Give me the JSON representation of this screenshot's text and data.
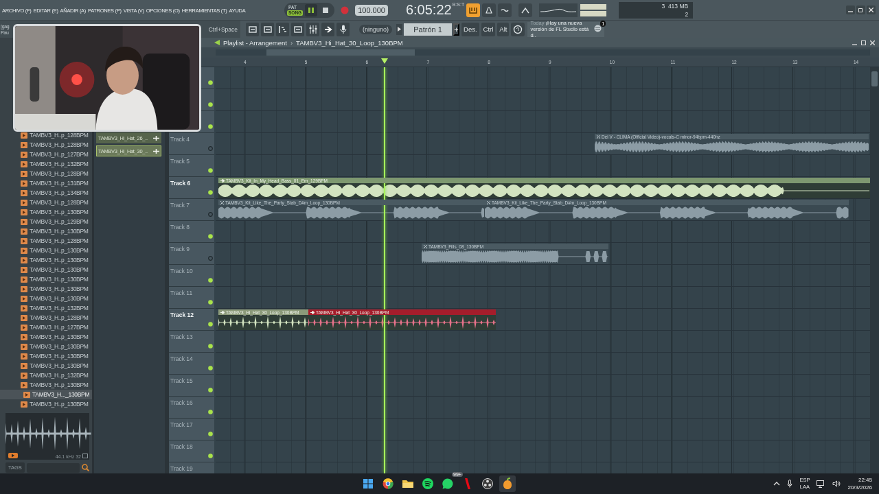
{
  "menu": [
    "ARCHIVO (F)",
    "EDITAR (E)",
    "AÑADIR (A)",
    "PATRONES (P)",
    "VISTA (V)",
    "OPCIONES (O)",
    "HERRAMIENTAS (T)",
    "AYUDA"
  ],
  "transport": {
    "modes": [
      {
        "label": "PAT",
        "selected": false
      },
      {
        "label": "SONG",
        "selected": true
      }
    ],
    "tempo": "100.000",
    "time": "6:05:22",
    "time_unit": "B:S:T",
    "cpu": "3",
    "memory": "413 MB",
    "polyphony": "2"
  },
  "hint_bar": {
    "lines": [
      "[gag",
      "Pau"
    ],
    "shortcut": "Ctrl+Space"
  },
  "pattern_selector": {
    "none_label": "(ninguno)",
    "pattern": "Patrón 1",
    "add": "+"
  },
  "snap_buttons": [
    "Des.",
    "Ctrl",
    "Alt"
  ],
  "news": {
    "when": "Today",
    "text": "¡Hay una nueva versión de FL Studio está d..",
    "count": "1"
  },
  "browser": {
    "items": [
      {
        "name": "TAMBV3_H..p_128BPM",
        "selected": false
      },
      {
        "name": "TAMBV3_H..p_128BPM",
        "selected": false
      },
      {
        "name": "TAMBV3_H..p_127BPM",
        "selected": false
      },
      {
        "name": "TAMBV3_H..p_132BPM",
        "selected": false
      },
      {
        "name": "TAMBV3_H..p_128BPM",
        "selected": false
      },
      {
        "name": "TAMBV3_H..p_131BPM",
        "selected": false
      },
      {
        "name": "TAMBV3_H..p_134BPM",
        "selected": false
      },
      {
        "name": "TAMBV3_H..p_128BPM",
        "selected": false
      },
      {
        "name": "TAMBV3_H..p_130BPM",
        "selected": false
      },
      {
        "name": "TAMBV3_H..p_129BPM",
        "selected": false
      },
      {
        "name": "TAMBV3_H..p_130BPM",
        "selected": false
      },
      {
        "name": "TAMBV3_H..p_128BPM",
        "selected": false
      },
      {
        "name": "TAMBV3_H..p_130BPM",
        "selected": false
      },
      {
        "name": "TAMBV3_H..p_130BPM",
        "selected": false
      },
      {
        "name": "TAMBV3_H..p_130BPM",
        "selected": false
      },
      {
        "name": "TAMBV3_H..p_130BPM",
        "selected": false
      },
      {
        "name": "TAMBV3_H..p_130BPM",
        "selected": false
      },
      {
        "name": "TAMBV3_H..p_130BPM",
        "selected": false
      },
      {
        "name": "TAMBV3_H..p_132BPM",
        "selected": false
      },
      {
        "name": "TAMBV3_H..p_128BPM",
        "selected": false
      },
      {
        "name": "TAMBV3_H..p_127BPM",
        "selected": false
      },
      {
        "name": "TAMBV3_H..p_130BPM",
        "selected": false
      },
      {
        "name": "TAMBV3_H..p_130BPM",
        "selected": false
      },
      {
        "name": "TAMBV3_H..p_130BPM",
        "selected": false
      },
      {
        "name": "TAMBV3_H..p_130BPM",
        "selected": false
      },
      {
        "name": "TAMBV3_H..p_132BPM",
        "selected": false
      },
      {
        "name": "TAMBV3_H..p_130BPM",
        "selected": false
      },
      {
        "name": "TAMBV3_H..._130BPM",
        "selected": true
      },
      {
        "name": "TAMBV3_H..p_130BPM",
        "selected": false
      }
    ],
    "preview_info": "44.1 kHz 32",
    "tags": "TAGS"
  },
  "picker": {
    "items": [
      {
        "name": "TAMBV3_Hi_Hat_26_..",
        "selected": false
      },
      {
        "name": "TAMBV3_Hi_Hat_30_..",
        "selected": true
      }
    ]
  },
  "playlist": {
    "title": "Playlist - Arrangement",
    "separator": "›",
    "pattern": "TAMBV3_Hi_Hat_30_Loop_130BPM",
    "ruler": [
      "4",
      "5",
      "6",
      "7",
      "8",
      "9",
      "10",
      "11",
      "12",
      "13",
      "14"
    ],
    "tracks": [
      {
        "enabled": true
      },
      {
        "enabled": true
      },
      {
        "enabled": true
      },
      {
        "label": "Track 4",
        "enabled": false,
        "active": false,
        "clips": [
          {
            "name": "Dei V - CLIMA (Official Video)-vocals-C minor-94bpm-440hz",
            "color": "#4a5a62",
            "muted": true,
            "kind": "vocal"
          }
        ]
      },
      {
        "label": "Track 5",
        "enabled": true,
        "active": false
      },
      {
        "label": "Track 6",
        "enabled": true,
        "active": true,
        "clips": [
          {
            "name": "TAMBV3_Kit_In_My_Head_Bass_01_Em_129BPM",
            "color": "#7e9870",
            "muted": false,
            "kind": "pulses"
          }
        ]
      },
      {
        "label": "Track 7",
        "enabled": false,
        "active": false,
        "clips": [
          {
            "name": "TAMBV3_Kit_Like_The_Party_Stab_D#m_Loop_130BPM",
            "color": "#4a5a62",
            "muted": true,
            "kind": "sustained"
          },
          {
            "name": "TAMBV3_Kit_Like_The_Party_Stab_D#m_Loop_130BPM",
            "color": "#4a5a62",
            "muted": true,
            "kind": "sustained"
          }
        ]
      },
      {
        "label": "Track 8",
        "enabled": true,
        "active": false
      },
      {
        "label": "Track 9",
        "enabled": false,
        "active": false,
        "clips": [
          {
            "name": "TAMBV3_Fills_08_130BPM",
            "color": "#4a5a62",
            "muted": true,
            "kind": "fills"
          }
        ]
      },
      {
        "label": "Track 10",
        "enabled": true,
        "active": false
      },
      {
        "label": "Track 11",
        "enabled": true,
        "active": false
      },
      {
        "label": "Track 12",
        "enabled": true,
        "active": true,
        "clips": [
          {
            "name": "TAMBV3_Hi_Hat_30_Loop_130BPM",
            "color": "#8c9a7a",
            "muted": false,
            "kind": "hits"
          },
          {
            "name": "TAMBV3_Hi_Hat_30_Loop_130BPM",
            "color": "#a51d2b",
            "muted": false,
            "kind": "hits"
          }
        ]
      },
      {
        "label": "Track 13",
        "enabled": true,
        "active": false
      },
      {
        "label": "Track 14",
        "enabled": true,
        "active": false
      },
      {
        "label": "Track 15",
        "enabled": true,
        "active": false
      },
      {
        "label": "Track 16",
        "enabled": true,
        "active": false
      },
      {
        "label": "Track 17",
        "enabled": true,
        "active": false
      },
      {
        "label": "Track 18",
        "enabled": true,
        "active": false
      },
      {
        "label": "Track 19",
        "active": false
      }
    ]
  },
  "taskbar": {
    "apps": [
      {
        "kind": "start",
        "active": false
      },
      {
        "kind": "browser",
        "active": false
      },
      {
        "kind": "files",
        "active": false
      },
      {
        "kind": "music",
        "active": false
      },
      {
        "kind": "chat",
        "active": false,
        "badge": "99+"
      },
      {
        "kind": "video",
        "active": false
      },
      {
        "kind": "recorder",
        "active": false
      },
      {
        "kind": "daw",
        "active": true
      }
    ],
    "lang": [
      "ESP",
      "LAA"
    ],
    "time": "22:45",
    "date": "20/3/2026"
  }
}
